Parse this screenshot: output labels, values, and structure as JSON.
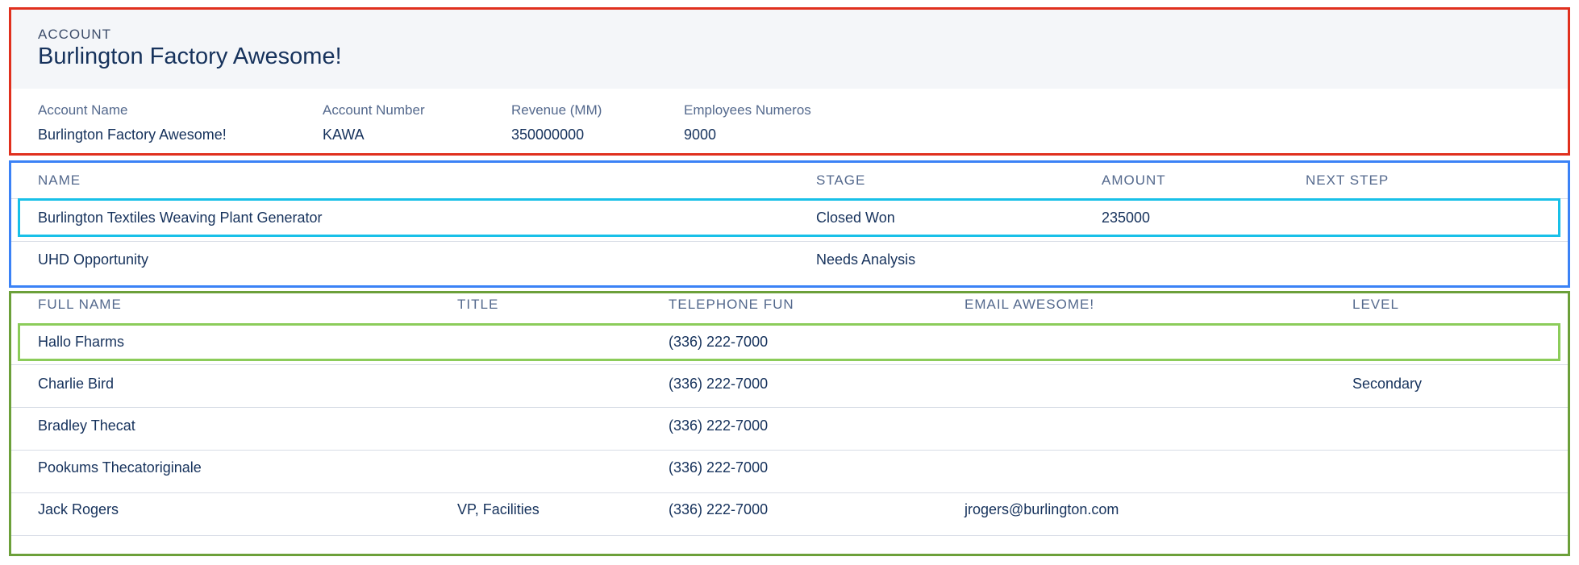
{
  "account": {
    "kicker": "ACCOUNT",
    "title": "Burlington Factory Awesome!",
    "fields": [
      {
        "label": "Account Name",
        "value": "Burlington Factory Awesome!"
      },
      {
        "label": "Account Number",
        "value": "KAWA"
      },
      {
        "label": "Revenue (MM)",
        "value": "350000000"
      },
      {
        "label": "Employees Numeros",
        "value": "9000"
      }
    ]
  },
  "opportunities": {
    "columns": [
      "NAME",
      "STAGE",
      "AMOUNT",
      "NEXT STEP"
    ],
    "rows": [
      {
        "name": "Burlington Textiles Weaving Plant Generator",
        "stage": "Closed Won",
        "amount": "235000",
        "next_step": ""
      },
      {
        "name": "UHD Opportunity",
        "stage": "Needs Analysis",
        "amount": "",
        "next_step": ""
      }
    ]
  },
  "contacts": {
    "columns": [
      "FULL NAME",
      "TITLE",
      "TELEPHONE FUN",
      "EMAIL AWESOME!",
      "LEVEL"
    ],
    "rows": [
      {
        "full_name": "Hallo Fharms",
        "title": "",
        "phone": "(336) 222-7000",
        "email": "",
        "level": ""
      },
      {
        "full_name": "Charlie Bird",
        "title": "",
        "phone": "(336) 222-7000",
        "email": "",
        "level": "Secondary"
      },
      {
        "full_name": "Bradley Thecat",
        "title": "",
        "phone": "(336) 222-7000",
        "email": "",
        "level": ""
      },
      {
        "full_name": "Pookums Thecatoriginale",
        "title": "",
        "phone": "(336) 222-7000",
        "email": "",
        "level": ""
      },
      {
        "full_name": "Jack Rogers",
        "title": "VP, Facilities",
        "phone": "(336) 222-7000",
        "email": "jrogers@burlington.com",
        "level": ""
      }
    ]
  },
  "colors": {
    "account_border": "#e0301e",
    "opportunities_border": "#3b82f6",
    "opportunities_highlight": "#18c0e8",
    "contacts_border": "#6ca03a",
    "contacts_highlight": "#8ccc5a",
    "text": "#16325c"
  }
}
